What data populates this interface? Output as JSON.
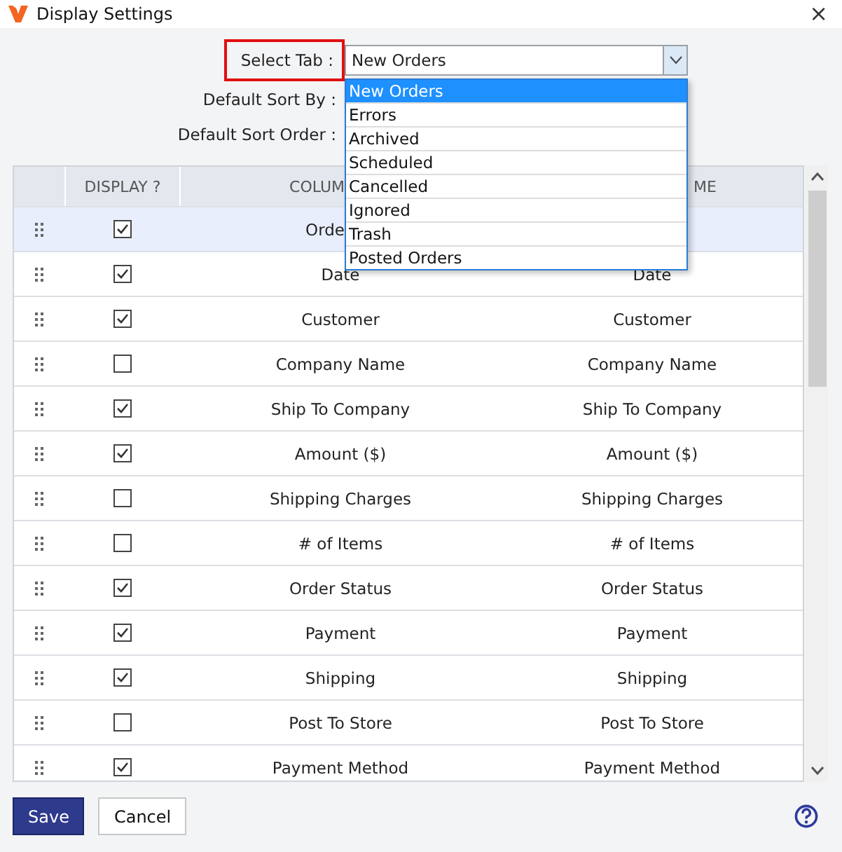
{
  "window": {
    "title": "Display Settings",
    "close": "×"
  },
  "form": [
    {
      "label": "Select Tab :",
      "highlighted": true,
      "value": "New Orders"
    },
    {
      "label": "Default Sort By :",
      "highlighted": false
    },
    {
      "label": "Default Sort Order :",
      "highlighted": false
    }
  ],
  "dropdown": [
    {
      "label": "New Orders",
      "selected": true
    },
    {
      "label": "Errors",
      "selected": false
    },
    {
      "label": "Archived",
      "selected": false
    },
    {
      "label": "Scheduled",
      "selected": false
    },
    {
      "label": "Cancelled",
      "selected": false
    },
    {
      "label": "Ignored",
      "selected": false
    },
    {
      "label": "Trash",
      "selected": false
    },
    {
      "label": "Posted Orders",
      "selected": false
    }
  ],
  "table": {
    "columns": [
      "DISPLAY ?",
      "COLUM",
      "ME"
    ],
    "rows": [
      {
        "checked": true,
        "selected": true,
        "column_name": "Orde"
      },
      {
        "checked": true,
        "selected": false,
        "column_name": "Date",
        "display_name": "Date"
      },
      {
        "checked": true,
        "selected": false,
        "column_name": "Customer",
        "display_name": "Customer"
      },
      {
        "checked": false,
        "selected": false,
        "column_name": "Company Name",
        "display_name": "Company Name"
      },
      {
        "checked": true,
        "selected": false,
        "column_name": "Ship To Company",
        "display_name": "Ship To Company"
      },
      {
        "checked": true,
        "selected": false,
        "column_name": "Amount ($)",
        "display_name": "Amount ($)"
      },
      {
        "checked": false,
        "selected": false,
        "column_name": "Shipping Charges",
        "display_name": "Shipping Charges"
      },
      {
        "checked": false,
        "selected": false,
        "column_name": "# of Items",
        "display_name": "# of Items"
      },
      {
        "checked": true,
        "selected": false,
        "column_name": "Order Status",
        "display_name": "Order Status"
      },
      {
        "checked": true,
        "selected": false,
        "column_name": "Payment",
        "display_name": "Payment"
      },
      {
        "checked": true,
        "selected": false,
        "column_name": "Shipping",
        "display_name": "Shipping"
      },
      {
        "checked": false,
        "selected": false,
        "column_name": "Post To Store",
        "display_name": "Post To Store"
      },
      {
        "checked": true,
        "selected": false,
        "column_name": "Payment Method",
        "display_name": "Payment Method"
      }
    ]
  },
  "buttons": [
    "Save",
    "Cancel"
  ]
}
